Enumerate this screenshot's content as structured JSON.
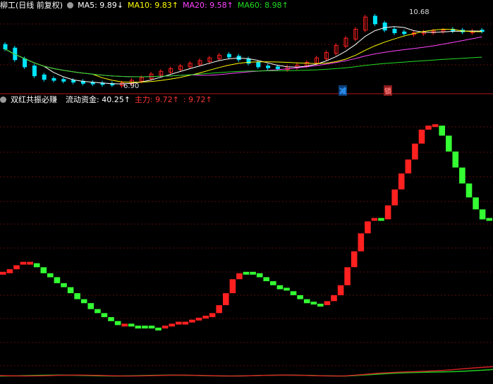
{
  "top_panel": {
    "stock_name": "柳工(日线 前复权)",
    "ma5": "MA5: 9.89↓",
    "ma10": "MA10: 9.83↑",
    "ma20": "MA20: 9.58↑",
    "ma60": "MA60: 8.98↑",
    "high_label": "10.68",
    "low_label": "6.90",
    "marker_1": "减",
    "marker_2": "锁",
    "colors": {
      "ma5": "#ffffff",
      "ma10": "#ffff00",
      "ma20": "#ff44ff",
      "ma60": "#22dd22"
    }
  },
  "bottom_panel": {
    "indicator_name": "双红共振必赚",
    "capital_label": "流动资金: 40.25↑",
    "main_label": "主力: 9.72↑",
    "extra_label": ": 9.72↑",
    "colors": {
      "up": "#ff2020",
      "down": "#33ff33"
    }
  },
  "chart_data": [
    {
      "type": "candlestick",
      "title": "柳工(日线 前复权)",
      "annotations": [
        "10.68",
        "6.90"
      ],
      "series": [
        {
          "name": "MA5",
          "last": 9.89
        },
        {
          "name": "MA10",
          "last": 9.83
        },
        {
          "name": "MA20",
          "last": 9.58
        },
        {
          "name": "MA60",
          "last": 8.98
        }
      ],
      "price_path": [
        8.9,
        8.3,
        7.9,
        7.4,
        7.2,
        7.15,
        7.1,
        7.05,
        6.98,
        6.95,
        6.92,
        6.9,
        7.0,
        7.15,
        7.3,
        7.5,
        7.65,
        7.8,
        7.95,
        8.1,
        8.25,
        8.4,
        8.55,
        8.45,
        8.3,
        8.1,
        7.9,
        7.85,
        7.8,
        7.9,
        8.0,
        8.15,
        8.4,
        8.7,
        9.1,
        9.5,
        10.0,
        10.68,
        10.3,
        9.95,
        9.8,
        9.75,
        9.8,
        9.85,
        9.9,
        9.95,
        9.9,
        9.85,
        9.9,
        9.89
      ],
      "bar_colors": [
        "down",
        "down",
        "down",
        "down",
        "down",
        "down",
        "down",
        "down",
        "down",
        "down",
        "down",
        "down",
        "up",
        "up",
        "up",
        "up",
        "up",
        "up",
        "up",
        "up",
        "up",
        "up",
        "up",
        "down",
        "down",
        "down",
        "down",
        "down",
        "down",
        "up",
        "up",
        "up",
        "up",
        "up",
        "up",
        "up",
        "up",
        "up",
        "down",
        "down",
        "down",
        "down",
        "up",
        "up",
        "up",
        "up",
        "down",
        "down",
        "up",
        "down"
      ]
    },
    {
      "type": "bar",
      "title": "双红共振必赚",
      "series": [
        {
          "name": "流动资金",
          "last": 40.25
        },
        {
          "name": "主力",
          "last": 9.72
        }
      ],
      "values": [
        46,
        48,
        50,
        51,
        51,
        49,
        46,
        44,
        41,
        39,
        36,
        33,
        31,
        28,
        26,
        24,
        22,
        20,
        20,
        19,
        19,
        19,
        18,
        18,
        19,
        20,
        21,
        21,
        22,
        23,
        24,
        26,
        30,
        36,
        43,
        46,
        46,
        46,
        44,
        42,
        40,
        38,
        37,
        35,
        33,
        31,
        30,
        30,
        32,
        35,
        40,
        49,
        57,
        66,
        72,
        73,
        73,
        80,
        88,
        96,
        103,
        111,
        118,
        120,
        120,
        115,
        107,
        99,
        91,
        84,
        78,
        73,
        72
      ],
      "colors": [
        "up",
        "up",
        "up",
        "up",
        "up",
        "down",
        "down",
        "down",
        "down",
        "down",
        "down",
        "down",
        "down",
        "down",
        "down",
        "down",
        "down",
        "down",
        "up",
        "down",
        "down",
        "down",
        "down",
        "down",
        "up",
        "up",
        "up",
        "up",
        "up",
        "up",
        "up",
        "up",
        "up",
        "up",
        "up",
        "up",
        "down",
        "down",
        "down",
        "down",
        "down",
        "down",
        "down",
        "down",
        "down",
        "down",
        "down",
        "down",
        "up",
        "up",
        "up",
        "up",
        "up",
        "up",
        "up",
        "up",
        "down",
        "up",
        "up",
        "up",
        "up",
        "up",
        "up",
        "up",
        "up",
        "down",
        "down",
        "down",
        "down",
        "down",
        "down",
        "down",
        "down"
      ],
      "ylim": [
        0,
        130
      ]
    }
  ]
}
